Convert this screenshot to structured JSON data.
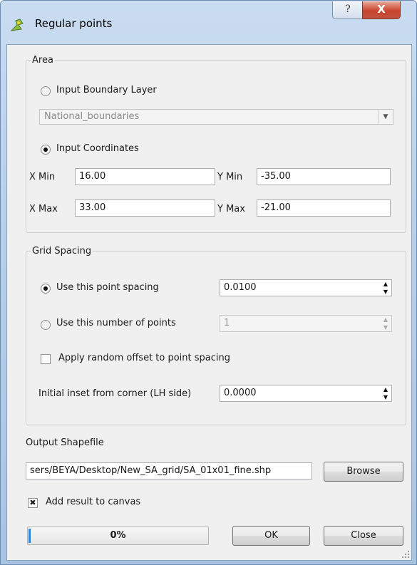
{
  "window": {
    "title": "Regular points",
    "help_glyph": "?",
    "close_glyph": "X"
  },
  "area": {
    "legend": "Area",
    "boundary_radio": "Input Boundary Layer",
    "boundary_combo": "National_boundaries",
    "coords_radio": "Input Coordinates",
    "xmin_label": "X Min",
    "xmin": "16.00",
    "ymin_label": "Y Min",
    "ymin": "-35.00",
    "xmax_label": "X Max",
    "xmax": "33.00",
    "ymax_label": "Y Max",
    "ymax": "-21.00"
  },
  "grid": {
    "legend": "Grid Spacing",
    "spacing_radio": "Use this point spacing",
    "spacing_value": "0.0100",
    "number_radio": "Use this number of points",
    "number_value": "1",
    "random_offset": "Apply random offset to point spacing",
    "inset_label": "Initial inset from corner (LH side)",
    "inset_value": "0.0000"
  },
  "output": {
    "label": "Output Shapefile",
    "path": "sers/BEYA/Desktop/New_SA_grid/SA_01x01_fine.shp",
    "browse": "Browse",
    "add_to_canvas": "Add result to canvas",
    "check_glyph": "✖"
  },
  "footer": {
    "progress_text": "0%",
    "progress_value": 0,
    "ok": "OK",
    "close": "Close"
  }
}
